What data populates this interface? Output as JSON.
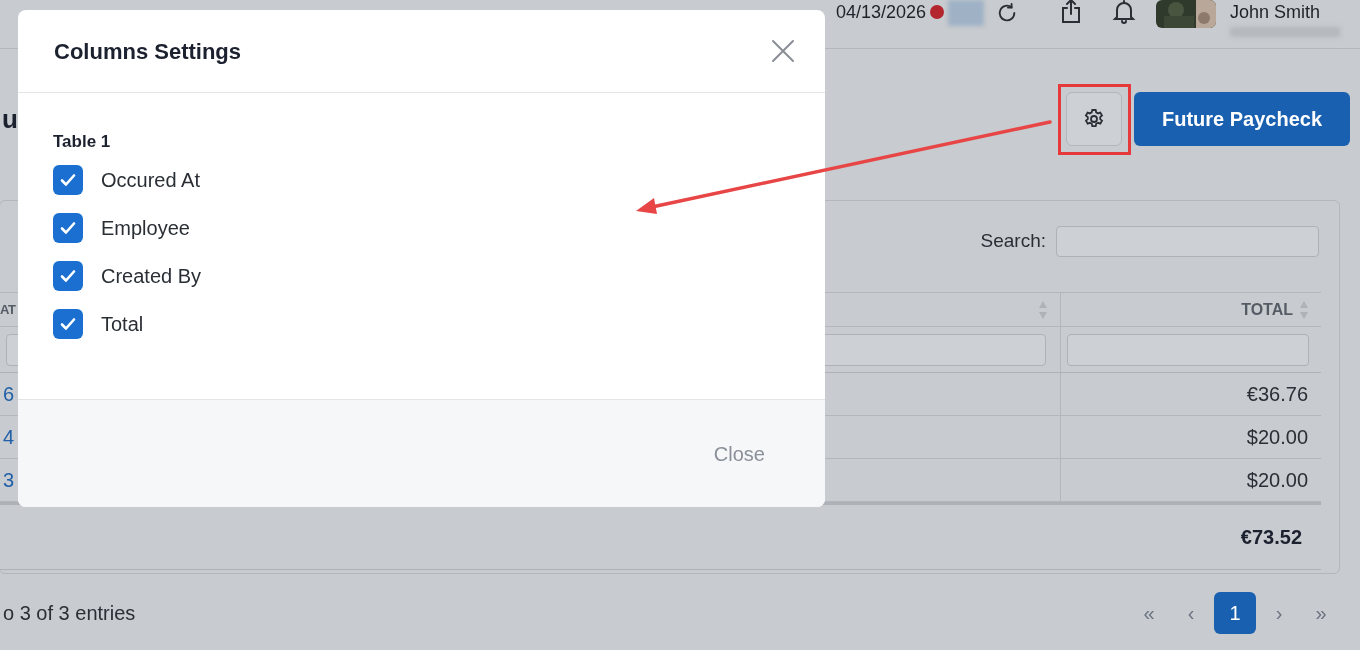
{
  "top_bar": {
    "date": "04/13/2026",
    "user_name": "John Smith"
  },
  "page": {
    "title_fragment": "u",
    "primary_button": "Future Paycheck"
  },
  "table": {
    "search_label": "Search:",
    "header_1": "AT",
    "header_3": "TOTAL",
    "rows": [
      {
        "column_1": "6",
        "total": "€36.76"
      },
      {
        "column_1": "4",
        "total": "$20.00"
      },
      {
        "column_1": "3",
        "total": "$20.00"
      }
    ],
    "footer_total": "€73.52",
    "info": "o 3 of 3 entries",
    "pagination": [
      {
        "label": "«",
        "selected": false
      },
      {
        "label": "‹",
        "selected": false
      },
      {
        "label": "1",
        "selected": true
      },
      {
        "label": "›",
        "selected": false
      },
      {
        "label": "»",
        "selected": false
      }
    ]
  },
  "modal": {
    "title": "Columns Settings",
    "section": "Table 1",
    "options": [
      {
        "label": "Occured At",
        "checked": true
      },
      {
        "label": "Employee",
        "checked": true
      },
      {
        "label": "Created By",
        "checked": true
      },
      {
        "label": "Total",
        "checked": true
      }
    ],
    "close_button": "Close"
  }
}
